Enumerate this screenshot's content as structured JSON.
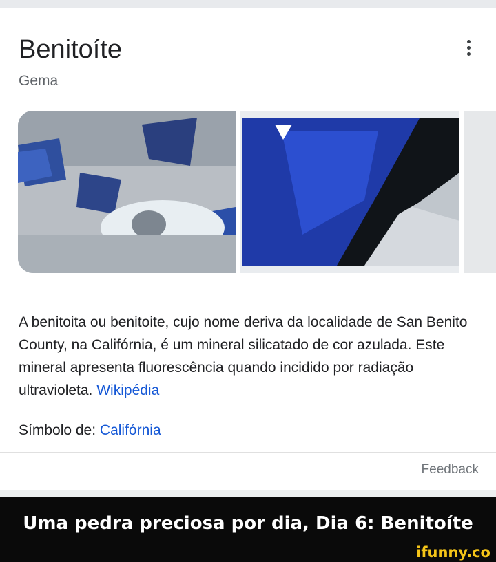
{
  "knowledge_panel": {
    "title": "Benitoíte",
    "subtitle": "Gema",
    "menu_icon": "more-vert-icon",
    "description": "A benitoita ou benitoite, cujo nome deriva da localidade de San Benito County, na Califórnia, é um mineral silicatado de cor azulada. Este mineral apresenta fluorescência quando incidido por radiação ultravioleta.",
    "source_link": "Wikipédia",
    "symbol_label": "Símbolo de:",
    "symbol_value": "Califórnia",
    "feedback_label": "Feedback"
  },
  "meme": {
    "caption": "Uma pedra preciosa por dia, Dia 6: Benitoíte",
    "watermark": "ifunny.co"
  },
  "colors": {
    "link": "#1558d6",
    "text": "#202124",
    "banner_bg": "#0a0a0a",
    "watermark": "#f5c518"
  }
}
